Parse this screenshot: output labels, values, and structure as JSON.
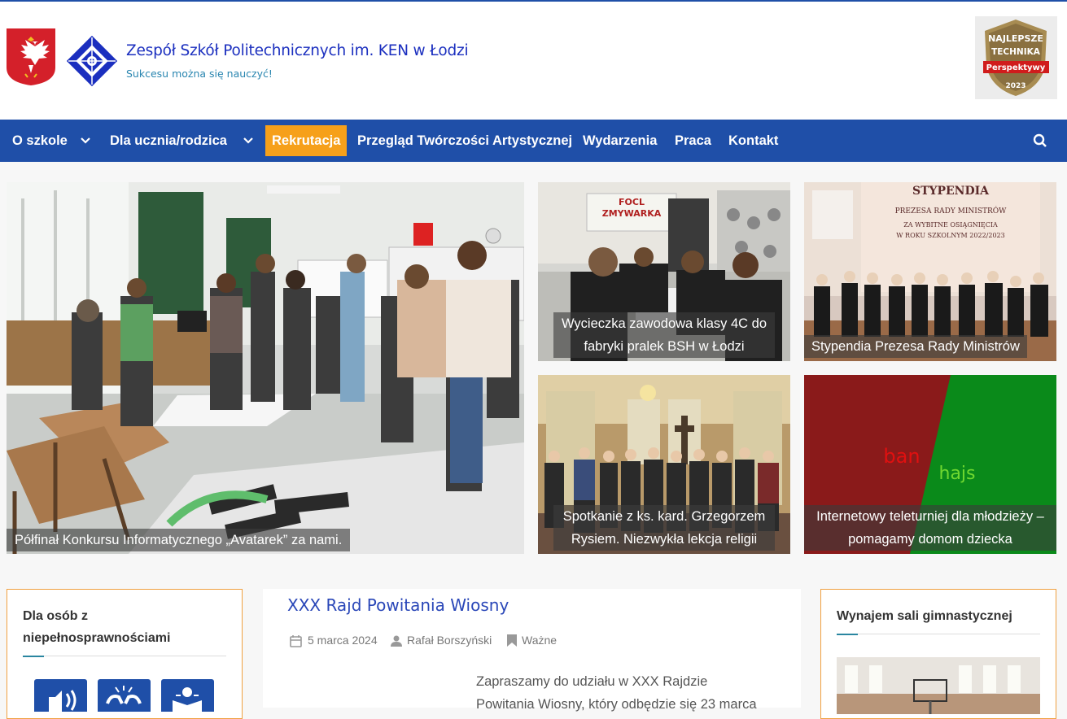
{
  "header": {
    "title": "Zespół Szkół Politechnicznych im. KEN w Łodzi",
    "tagline": "Sukcesu można się nauczyć!",
    "award": {
      "line1": "NAJLEPSZE",
      "line2": "TECHNIKA",
      "ribbon": "Perspektywy",
      "year": "2023"
    }
  },
  "nav": {
    "items": [
      {
        "label": "O szkole",
        "dropdown": true
      },
      {
        "label": "Dla ucznia/rodzica",
        "dropdown": true
      },
      {
        "label": "Rekrutacja",
        "active": true
      },
      {
        "label": "Przegląd Twórczości Artystycznej"
      },
      {
        "label": "Wydarzenia"
      },
      {
        "label": "Praca"
      },
      {
        "label": "Kontakt"
      }
    ],
    "search_icon": "search-icon"
  },
  "featured": [
    {
      "caption": "Półfinał Konkursu Informatycznego „Avatarek” za nami."
    },
    {
      "caption_line1": "Wycieczka zawodowa klasy 4C do",
      "caption_line2": "fabryki pralek BSH w Łodzi",
      "sign1": "FOCL",
      "sign2": "ZMYWARKA"
    },
    {
      "caption": "Stypendia Prezesa Rady Ministrów",
      "slide_title": "STYPENDIA",
      "slide_l1": "PREZESA RADY MINISTRÓW",
      "slide_l2": "ZA WYBITNE OSIĄGNIĘCIA",
      "slide_l3": "W ROKU SZKOLNYM 2022/2023"
    },
    {
      "caption_line1": "Spotkanie z ks. kard. Grzegorzem",
      "caption_line2": "Rysiem. Niezwykła lekcja religii"
    },
    {
      "caption_line1": "Internetowy teleturniej dla młodzieży –",
      "caption_line2": "pomagamy domom dziecka",
      "word1": "ban",
      "word2": "hajs"
    }
  ],
  "left_widget": {
    "title_line1": "Dla osób z",
    "title_line2": "niepełnosprawnościami",
    "icons": [
      "speaker-icon",
      "sign-language-icon",
      "easy-read-icon"
    ]
  },
  "post": {
    "title": "XXX Rajd Powitania Wiosny",
    "date": "5 marca 2024",
    "author": "Rafał Borszyński",
    "category": "Ważne",
    "excerpt_line1": "Zapraszamy do udziału w XXX Rajdzie",
    "excerpt_line2": "Powitania Wiosny, który odbędzie się 23 marca"
  },
  "right_widget": {
    "title": "Wynajem sali gimnastycznej"
  },
  "colors": {
    "nav": "#1f4fa8",
    "active": "#f6a01a",
    "title": "#1b2fbf",
    "accent": "#f0a040"
  }
}
